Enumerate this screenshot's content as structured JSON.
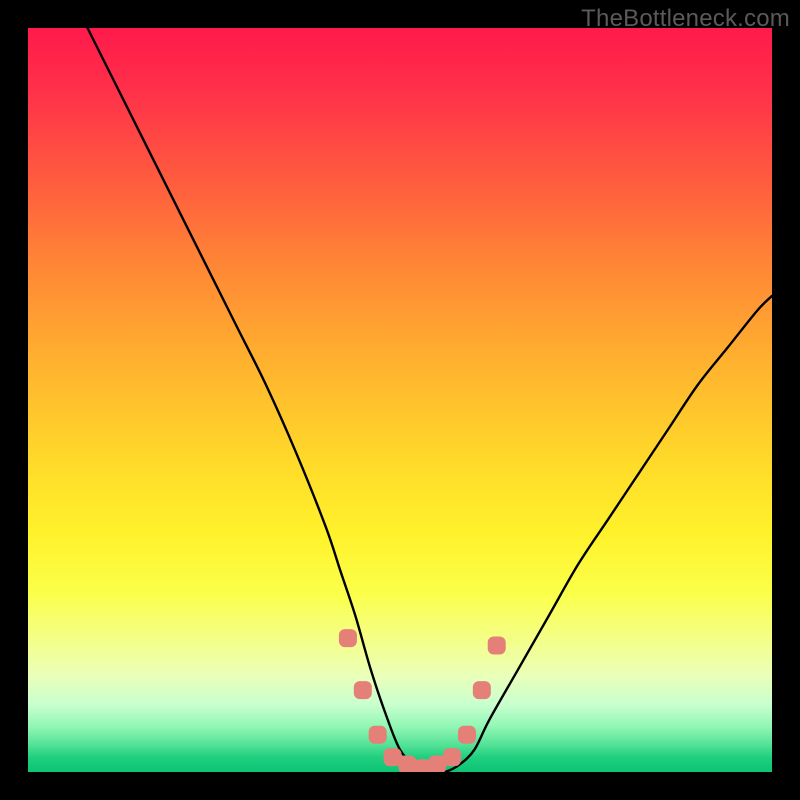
{
  "watermark": "TheBottleneck.com",
  "chart_data": {
    "type": "line",
    "title": "",
    "xlabel": "",
    "ylabel": "",
    "ylim": [
      0,
      100
    ],
    "xlim": [
      0,
      100
    ],
    "series": [
      {
        "name": "bottleneck-curve",
        "x": [
          8,
          12,
          16,
          20,
          24,
          28,
          32,
          36,
          40,
          42,
          44,
          46,
          48,
          50,
          52,
          54,
          56,
          58,
          60,
          62,
          66,
          70,
          74,
          78,
          82,
          86,
          90,
          94,
          98,
          100
        ],
        "values": [
          100,
          92,
          84,
          76,
          68,
          60,
          52,
          43,
          33,
          27,
          21,
          14,
          8,
          3,
          1,
          0,
          0,
          1,
          3,
          7,
          14,
          21,
          28,
          34,
          40,
          46,
          52,
          57,
          62,
          64
        ]
      }
    ],
    "markers": {
      "name": "highlighted-points",
      "color": "#e58079",
      "x": [
        43,
        45,
        47,
        49,
        51,
        53,
        55,
        57,
        59,
        61,
        63
      ],
      "y": [
        18,
        11,
        5,
        2,
        1,
        0.5,
        1,
        2,
        5,
        11,
        17
      ],
      "shape": "rounded-rect"
    },
    "gradient_stops": [
      {
        "pos": 0,
        "color": "#ff1a4b"
      },
      {
        "pos": 8,
        "color": "#ff2f4a"
      },
      {
        "pos": 20,
        "color": "#ff5a3f"
      },
      {
        "pos": 33,
        "color": "#ff8a35"
      },
      {
        "pos": 46,
        "color": "#ffb52e"
      },
      {
        "pos": 58,
        "color": "#ffd92a"
      },
      {
        "pos": 68,
        "color": "#fff22b"
      },
      {
        "pos": 76,
        "color": "#fbff4a"
      },
      {
        "pos": 82,
        "color": "#f4ff86"
      },
      {
        "pos": 87,
        "color": "#eaffb8"
      },
      {
        "pos": 91,
        "color": "#c8ffcf"
      },
      {
        "pos": 94,
        "color": "#8ef6b3"
      },
      {
        "pos": 96.5,
        "color": "#4fe095"
      },
      {
        "pos": 98,
        "color": "#20cf80"
      },
      {
        "pos": 100,
        "color": "#0cc574"
      }
    ]
  }
}
